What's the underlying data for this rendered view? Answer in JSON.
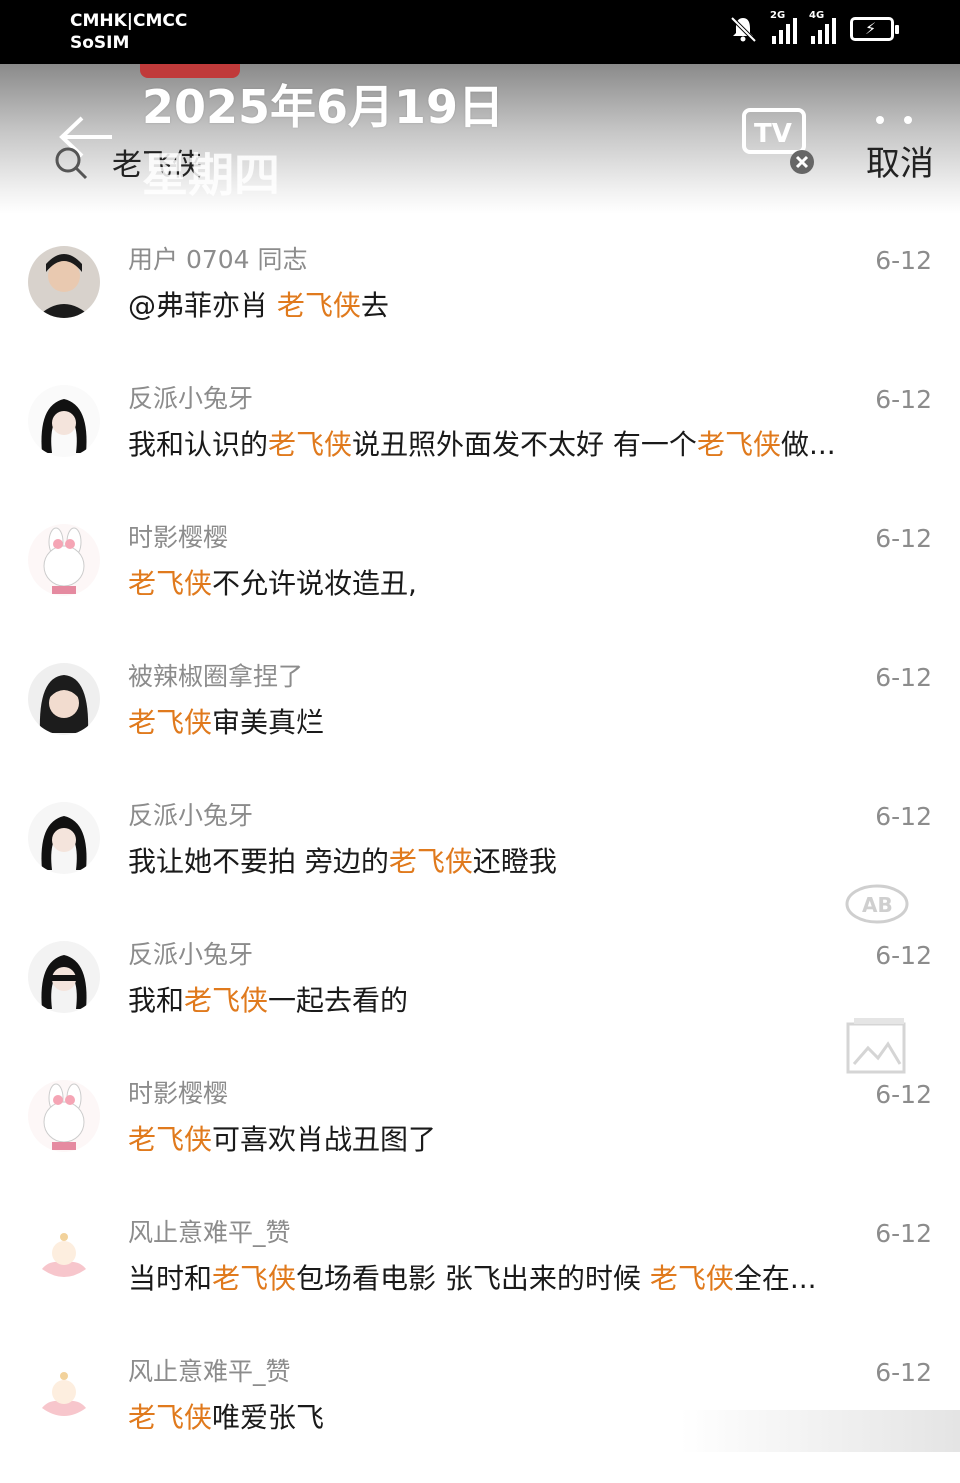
{
  "status_bar": {
    "carrier_line1": "CMHK|CMCC",
    "carrier_line2": "SoSIM",
    "signal1_tag": "2G",
    "signal2_tag": "4G"
  },
  "overlay": {
    "date": "2025年6月19日",
    "weekday": "星期四"
  },
  "header": {
    "search_query": "老飞侠",
    "cancel_label": "取消"
  },
  "colors": {
    "highlight": "#e07a1d",
    "username": "#8c8c8c",
    "text": "#1a1a1a"
  },
  "icons": [
    "back-arrow-icon",
    "search-icon",
    "tv-cast-icon",
    "more-icon",
    "mute-bell-icon",
    "signal-icon",
    "battery-charging-icon",
    "translate-ab-icon",
    "image-icon"
  ],
  "results": [
    {
      "username": "用户 0704 同志",
      "date": "6-12",
      "segments": [
        {
          "text": "@弗菲亦肖 ",
          "hl": false
        },
        {
          "text": "老飞侠",
          "hl": true
        },
        {
          "text": "去",
          "hl": false
        }
      ]
    },
    {
      "username": "反派小兔牙",
      "date": "6-12",
      "segments": [
        {
          "text": "我和认识的",
          "hl": false
        },
        {
          "text": "老飞侠",
          "hl": true
        },
        {
          "text": "说丑照外面发不太好 有一个",
          "hl": false
        },
        {
          "text": "老飞侠",
          "hl": true
        },
        {
          "text": "做...",
          "hl": false
        }
      ]
    },
    {
      "username": "时影樱樱",
      "date": "6-12",
      "segments": [
        {
          "text": "老飞侠",
          "hl": true
        },
        {
          "text": "不允许说妆造丑,",
          "hl": false
        }
      ]
    },
    {
      "username": "被辣椒圈拿捏了",
      "date": "6-12",
      "segments": [
        {
          "text": "老飞侠",
          "hl": true
        },
        {
          "text": "审美真烂",
          "hl": false
        }
      ]
    },
    {
      "username": "反派小兔牙",
      "date": "6-12",
      "segments": [
        {
          "text": "我让她不要拍 旁边的",
          "hl": false
        },
        {
          "text": "老飞侠",
          "hl": true
        },
        {
          "text": "还瞪我",
          "hl": false
        }
      ]
    },
    {
      "username": "反派小兔牙",
      "date": "6-12",
      "segments": [
        {
          "text": "我和",
          "hl": false
        },
        {
          "text": "老飞侠",
          "hl": true
        },
        {
          "text": "一起去看的",
          "hl": false
        }
      ]
    },
    {
      "username": "时影樱樱",
      "date": "6-12",
      "segments": [
        {
          "text": "老飞侠",
          "hl": true
        },
        {
          "text": "可喜欢肖战丑图了",
          "hl": false
        }
      ]
    },
    {
      "username": "风止意难平_赞",
      "date": "6-12",
      "segments": [
        {
          "text": "当时和",
          "hl": false
        },
        {
          "text": "老飞侠",
          "hl": true
        },
        {
          "text": "包场看电影 张飞出来的时候 ",
          "hl": false
        },
        {
          "text": "老飞侠",
          "hl": true
        },
        {
          "text": "全在...",
          "hl": false
        }
      ]
    },
    {
      "username": "风止意难平_赞",
      "date": "6-12",
      "segments": [
        {
          "text": "老飞侠",
          "hl": true
        },
        {
          "text": "唯爱张飞",
          "hl": false
        }
      ]
    }
  ],
  "floating": {
    "ab_label": "AB"
  }
}
